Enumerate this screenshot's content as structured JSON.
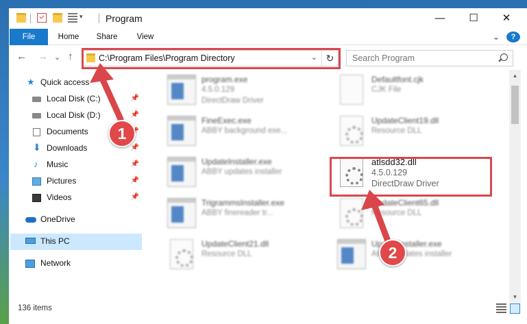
{
  "window": {
    "title": "Program",
    "minimize_glyph": "—",
    "maximize_glyph": "☐",
    "close_glyph": "✕",
    "help_glyph": "?"
  },
  "ribbon": {
    "tabs": [
      "File",
      "Home",
      "Share",
      "View"
    ],
    "expand_glyph": "⌄"
  },
  "navigation": {
    "back_glyph": "←",
    "forward_glyph": "→",
    "recent_glyph": "⌄",
    "up_glyph": "↑",
    "address": "C:\\Program Files\\Program Directory",
    "address_dropdown_glyph": "⌄",
    "refresh_glyph": "↻",
    "search_placeholder": "Search Program"
  },
  "sidebar": {
    "pin_glyph": "📌",
    "items": [
      {
        "label": "Quick access",
        "icon": "star-icon",
        "pinned": false
      },
      {
        "label": "Local Disk (C:)",
        "icon": "disk-icon",
        "pinned": true
      },
      {
        "label": "Local Disk (D:)",
        "icon": "disk-icon",
        "pinned": true
      },
      {
        "label": "Documents",
        "icon": "documents-icon",
        "pinned": true
      },
      {
        "label": "Downloads",
        "icon": "download-icon",
        "pinned": true
      },
      {
        "label": "Music",
        "icon": "music-icon",
        "pinned": true
      },
      {
        "label": "Pictures",
        "icon": "pictures-icon",
        "pinned": true
      },
      {
        "label": "Videos",
        "icon": "videos-icon",
        "pinned": true
      },
      {
        "label": "OneDrive",
        "icon": "cloud-icon",
        "pinned": false
      },
      {
        "label": "This PC",
        "icon": "computer-icon",
        "pinned": false,
        "selected": true
      },
      {
        "label": "Network",
        "icon": "network-icon",
        "pinned": false
      }
    ],
    "glyphs": {
      "star": "★",
      "download": "⬇",
      "music": "♪"
    }
  },
  "files": [
    {
      "name": "program.exe",
      "line2": "4.5.0.129",
      "line3": "DirectDraw Driver",
      "icon": "exe-icon"
    },
    {
      "name": "Defaultfont.cjk",
      "line2": "CJK File",
      "line3": "",
      "icon": "file-icon"
    },
    {
      "name": "FineExec.exe",
      "line2": "ABBY background exe...",
      "line3": "",
      "icon": "exe-icon"
    },
    {
      "name": "UpdateClient19.dll",
      "line2": "Resource DLL",
      "line3": "",
      "icon": "dll-icon"
    },
    {
      "name": "UpdateInstaller.exe",
      "line2": "ABBY updates installer",
      "line3": "",
      "icon": "exe-icon"
    },
    {
      "name": "atlsdd32.dll",
      "line2": "4.5.0.129",
      "line3": "DirectDraw Driver",
      "icon": "dll-icon",
      "highlighted": true
    },
    {
      "name": "TrigrammsInstaller.exe",
      "line2": "ABBY finereader tr...",
      "line3": "",
      "icon": "exe-icon"
    },
    {
      "name": "UpdateClient65.dll",
      "line2": "Resource DLL",
      "line3": "",
      "icon": "dll-icon"
    },
    {
      "name": "UpdateClient21.dll",
      "line2": "Resource DLL",
      "line3": "",
      "icon": "dll-icon"
    },
    {
      "name": "UpdateInstaller.exe",
      "line2": "ABBY updates installer",
      "line3": "",
      "icon": "exe-icon"
    }
  ],
  "status": {
    "item_count": "136 items"
  },
  "scrollbar": {
    "up_glyph": "▲",
    "down_glyph": "▼",
    "position": 0.1
  },
  "annotations": {
    "color": "#d9474b",
    "steps": [
      {
        "number": "1",
        "target": "address-bar"
      },
      {
        "number": "2",
        "target": "file-atlsdd32"
      }
    ]
  }
}
